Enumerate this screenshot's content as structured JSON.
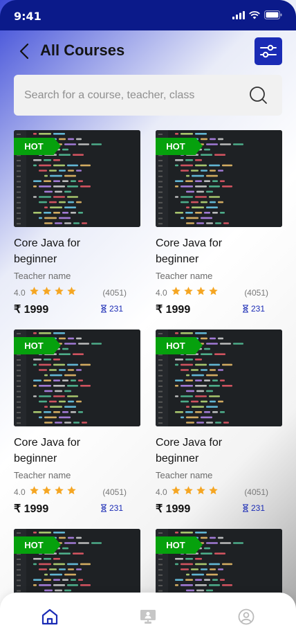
{
  "status_bar": {
    "time": "9:41"
  },
  "header": {
    "title": "All Courses"
  },
  "search": {
    "placeholder": "Search for a course, teacher, class"
  },
  "courses": [
    {
      "badge": "HOT",
      "title": "Core Java for beginner",
      "teacher": "Teacher name",
      "rating": "4.0",
      "stars": 4,
      "reviews": "(4051)",
      "price": "₹ 1999",
      "enrolled": "231"
    },
    {
      "badge": "HOT",
      "title": "Core Java for beginner",
      "teacher": "Teacher name",
      "rating": "4.0",
      "stars": 4,
      "reviews": "(4051)",
      "price": "₹ 1999",
      "enrolled": "231"
    },
    {
      "badge": "HOT",
      "title": "Core Java for beginner",
      "teacher": "Teacher name",
      "rating": "4.0",
      "stars": 4,
      "reviews": "(4051)",
      "price": "₹ 1999",
      "enrolled": "231"
    },
    {
      "badge": "HOT",
      "title": "Core Java for beginner",
      "teacher": "Teacher name",
      "rating": "4.0",
      "stars": 4,
      "reviews": "(4051)",
      "price": "₹ 1999",
      "enrolled": "231"
    },
    {
      "badge": "HOT"
    },
    {
      "badge": "HOT"
    }
  ],
  "bottom_nav": [
    {
      "icon": "home-icon",
      "active": true
    },
    {
      "icon": "classroom-icon",
      "active": false
    },
    {
      "icon": "profile-icon",
      "active": false
    }
  ],
  "colors": {
    "accent": "#1a2bb5",
    "hot_badge": "#06a10d",
    "star": "#f5a623"
  }
}
